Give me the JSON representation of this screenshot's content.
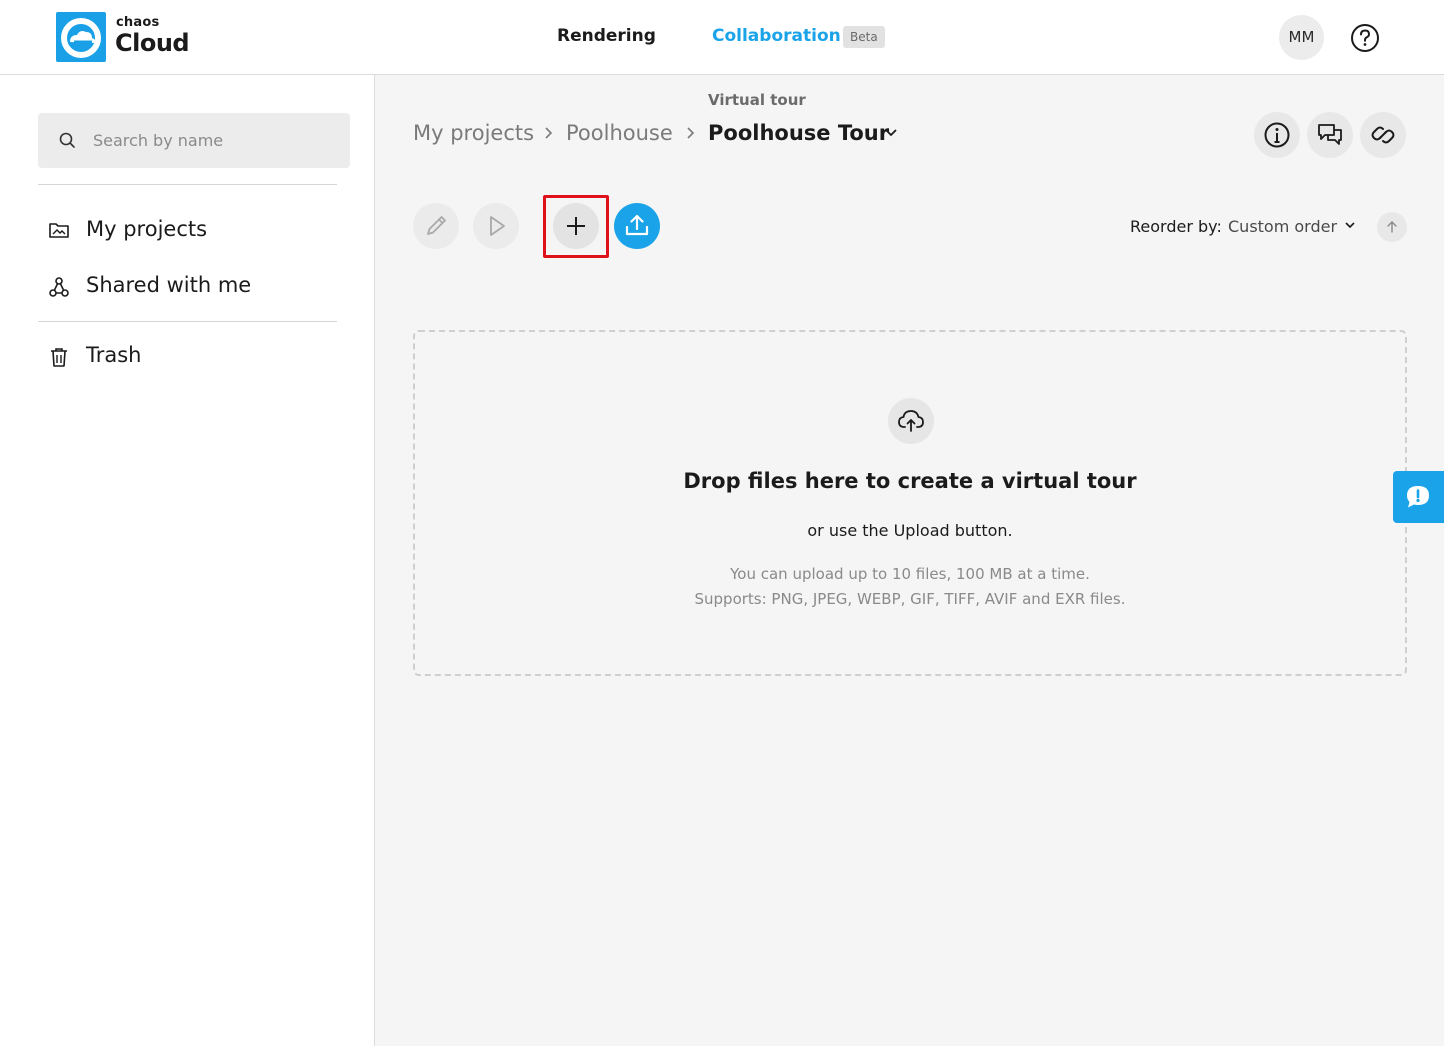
{
  "header": {
    "logo": {
      "brand_small": "chaos",
      "brand_big": "Cloud",
      "icon": "chaos-cloud-logo-icon"
    },
    "nav": {
      "rendering": "Rendering",
      "collaboration": "Collaboration",
      "beta": "Beta"
    },
    "avatar_initials": "MM",
    "help_icon": "help-circle-icon"
  },
  "sidebar": {
    "search": {
      "placeholder": "Search by name",
      "value": ""
    },
    "items": [
      {
        "label": "My projects",
        "icon": "image-folder-icon"
      },
      {
        "label": "Shared with me",
        "icon": "share-nodes-icon"
      },
      {
        "label": "Trash",
        "icon": "trash-icon"
      }
    ]
  },
  "main": {
    "breadcrumb": {
      "kicker": "Virtual tour",
      "items": [
        "My projects",
        "Poolhouse"
      ],
      "current": "Poolhouse Tour"
    },
    "top_actions": [
      "info-icon",
      "comments-icon",
      "link-icon"
    ],
    "toolbar": {
      "buttons": [
        "edit-icon",
        "play-icon",
        "plus-icon",
        "upload-icon"
      ],
      "reorder_label": "Reorder by:",
      "reorder_value": "Custom order"
    },
    "dropzone": {
      "title": "Drop files here to create a virtual tour",
      "subtitle": "or use the Upload button.",
      "note_line1": "You can upload up to 10 files, 100 MB at a time.",
      "note_line2": "Supports: PNG, JPEG, WEBP, GIF, TIFF, AVIF and EXR files."
    }
  },
  "colors": {
    "accent": "#1aa3e8",
    "highlight": "#e0101a"
  }
}
